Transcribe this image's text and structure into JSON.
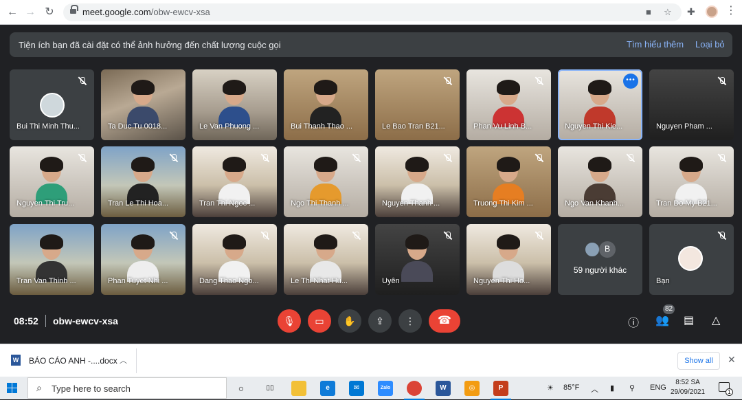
{
  "browser": {
    "url_host": "meet.google.com",
    "url_path": "/obw-ewcv-xsa"
  },
  "banner": {
    "text": "Tiện ích bạn đã cài đặt có thể ảnh hưởng đến chất lượng cuộc gọi",
    "learn_more": "Tìm hiểu thêm",
    "dismiss": "Loại bỏ"
  },
  "participants": [
    {
      "name": "Bui Thi Minh Thu..."
    },
    {
      "name": "Ta Duc Tu 0018..."
    },
    {
      "name": "Le Van Phuong ..."
    },
    {
      "name": "Bui Thanh Thao ..."
    },
    {
      "name": "Le Bao Tran B21..."
    },
    {
      "name": "Phan Vu Linh B..."
    },
    {
      "name": "Nguyen Thi Kie..."
    },
    {
      "name": "Nguyen Pham ..."
    },
    {
      "name": "Nguyen Thi Tru..."
    },
    {
      "name": "Tran Le Thi Hoa..."
    },
    {
      "name": "Tran Thi Ngoc ..."
    },
    {
      "name": "Ngo Thi Thanh ..."
    },
    {
      "name": "Nguyen Thanh ..."
    },
    {
      "name": "Truong Thi Kim ..."
    },
    {
      "name": "Ngo Van Khanh..."
    },
    {
      "name": "Tran Do My B21..."
    },
    {
      "name": "Tran Van Thinh ..."
    },
    {
      "name": "Phan Tuyet Nhi ..."
    },
    {
      "name": "Dang Thao Ngo..."
    },
    {
      "name": "Le Thi Nhat Hu..."
    },
    {
      "name": "Uyên"
    },
    {
      "name": "Nguyen Thi Ho..."
    }
  ],
  "others": {
    "avatar_letter": "B",
    "label": "59 người khác"
  },
  "self": {
    "name": "Bạn"
  },
  "meeting": {
    "time": "08:52",
    "code": "obw-ewcv-xsa",
    "people_count": "82"
  },
  "downloads": {
    "file_name": "BÁO CÁO ANH -....docx",
    "show_all": "Show all"
  },
  "taskbar": {
    "search_placeholder": "Type here to search",
    "weather": "85°F",
    "language": "ENG",
    "time": "8:52 SA",
    "date": "29/09/2021",
    "notifications": "1"
  }
}
